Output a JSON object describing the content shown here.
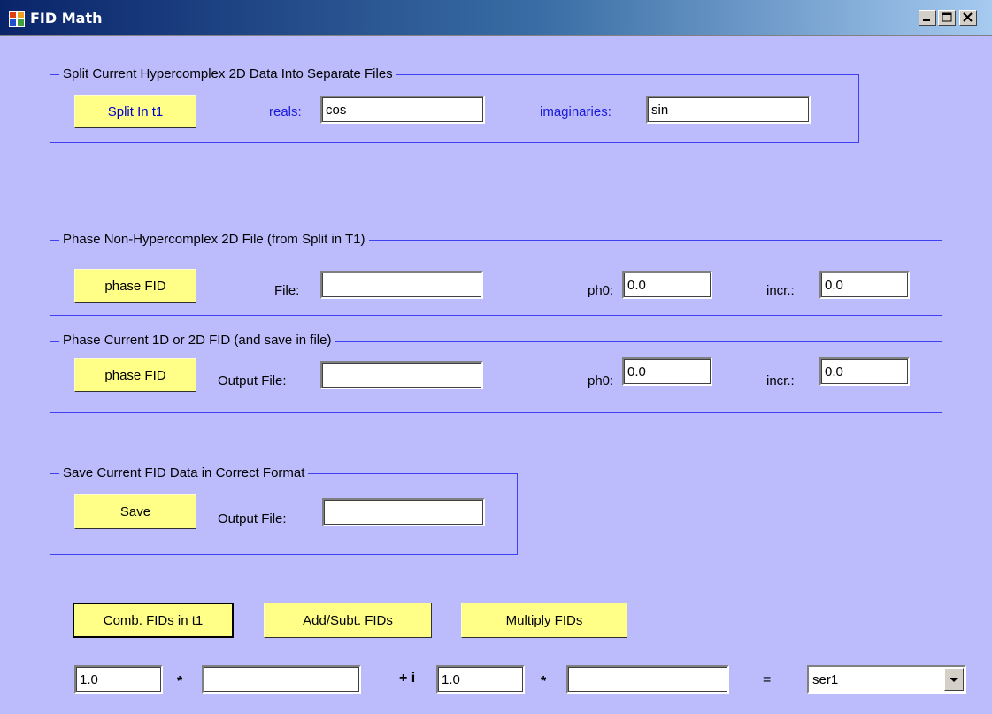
{
  "window": {
    "title": "FID Math"
  },
  "split_group": {
    "title": "Split Current Hypercomplex 2D Data Into Separate Files",
    "button": "Split In t1",
    "reals_label": "reals:",
    "reals_value": "cos",
    "imag_label": "imaginaries:",
    "imag_value": "sin"
  },
  "phase_non_group": {
    "title": "Phase Non-Hypercomplex 2D File (from Split in T1)",
    "button": "phase FID",
    "file_label": "File:",
    "file_value": "",
    "ph0_label": "ph0:",
    "ph0_value": "0.0",
    "incr_label": "incr.:",
    "incr_value": "0.0"
  },
  "phase_current_group": {
    "title": "Phase Current 1D or 2D FID (and save in file)",
    "button": "phase FID",
    "file_label": "Output File:",
    "file_value": "",
    "ph0_label": "ph0:",
    "ph0_value": "0.0",
    "incr_label": "incr.:",
    "incr_value": "0.0"
  },
  "save_group": {
    "title": "Save Current FID Data in Correct Format",
    "button": "Save",
    "file_label": "Output File:",
    "file_value": ""
  },
  "bottom": {
    "comb_button": "Comb. FIDs in t1",
    "add_button": "Add/Subt. FIDs",
    "mult_button": "Multiply FIDs",
    "coef1_value": "1.0",
    "mul1": "*",
    "operand1_value": "",
    "plus_i": "+ i",
    "coef2_value": "1.0",
    "mul2": "*",
    "operand2_value": "",
    "equals": "=",
    "result_value": "ser1"
  }
}
